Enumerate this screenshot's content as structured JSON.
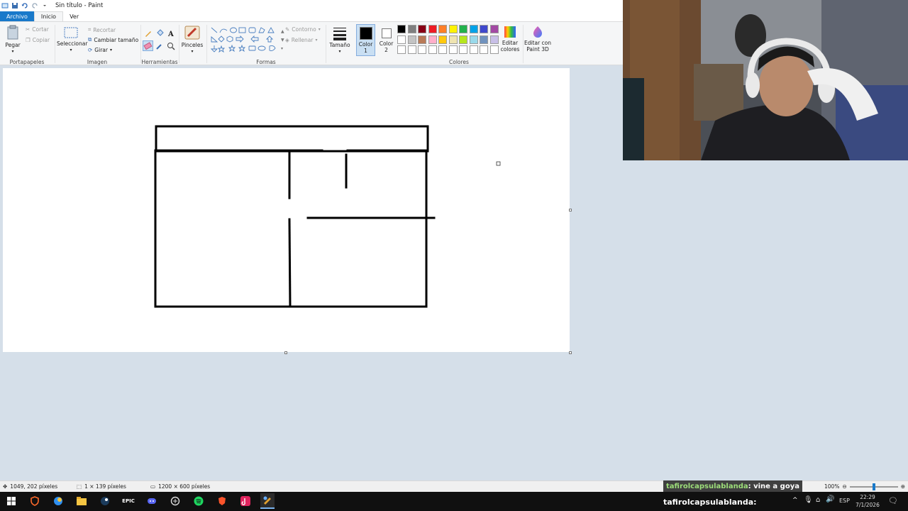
{
  "window": {
    "title": "Sin título - Paint"
  },
  "tabs": [
    {
      "label": "Archivo"
    },
    {
      "label": "Inicio"
    },
    {
      "label": "Ver"
    }
  ],
  "ribbon": {
    "clipboard": {
      "label": "Portapapeles",
      "paste": "Pegar",
      "cut": "Cortar",
      "copy": "Copiar"
    },
    "image": {
      "label": "Imagen",
      "select": "Seleccionar",
      "crop": "Recortar",
      "resize": "Cambiar tamaño",
      "rotate": "Girar"
    },
    "tools": {
      "label": "Herramientas"
    },
    "brushes": {
      "label": "Pinceles"
    },
    "shapes": {
      "label": "Formas",
      "outline": "Contorno",
      "fill": "Rellenar"
    },
    "size": {
      "label": "Tamaño"
    },
    "color1": {
      "label1": "Color",
      "label2": "1",
      "value": "#000000"
    },
    "color2": {
      "label1": "Color",
      "label2": "2",
      "value": "#ffffff"
    },
    "colors": {
      "label": "Colores",
      "row1": [
        "#000000",
        "#7f7f7f",
        "#880015",
        "#ed1c24",
        "#ff7f27",
        "#fff200",
        "#22b14c",
        "#00a2e8",
        "#3f48cc",
        "#a349a4"
      ],
      "row2": [
        "#ffffff",
        "#c3c3c3",
        "#b97a57",
        "#ffaec9",
        "#ffc90e",
        "#efe4b0",
        "#b5e61d",
        "#99d9ea",
        "#7092be",
        "#c8bfe7"
      ],
      "row3": [
        "#ffffff",
        "#ffffff",
        "#ffffff",
        "#ffffff",
        "#ffffff",
        "#ffffff",
        "#ffffff",
        "#ffffff",
        "#ffffff",
        "#ffffff"
      ],
      "edit1": "Editar",
      "edit2": "colores"
    },
    "paint3d": {
      "label1": "Editar con",
      "label2": "Paint 3D"
    }
  },
  "status": {
    "cursor_pos": "1049, 202 píxeles",
    "selection_size": "1 × 139 píxeles",
    "image_size": "1200 × 600 píxeles",
    "zoom": "100%"
  },
  "chat": [
    {
      "user": "tafirolcapsulablanda",
      "message": " : vine a goya"
    },
    {
      "user": "tafirolcapsulablanda",
      "message": " :"
    }
  ],
  "taskbar": {
    "language": "ESP",
    "time": "22:29",
    "date": "7/1/2026"
  }
}
